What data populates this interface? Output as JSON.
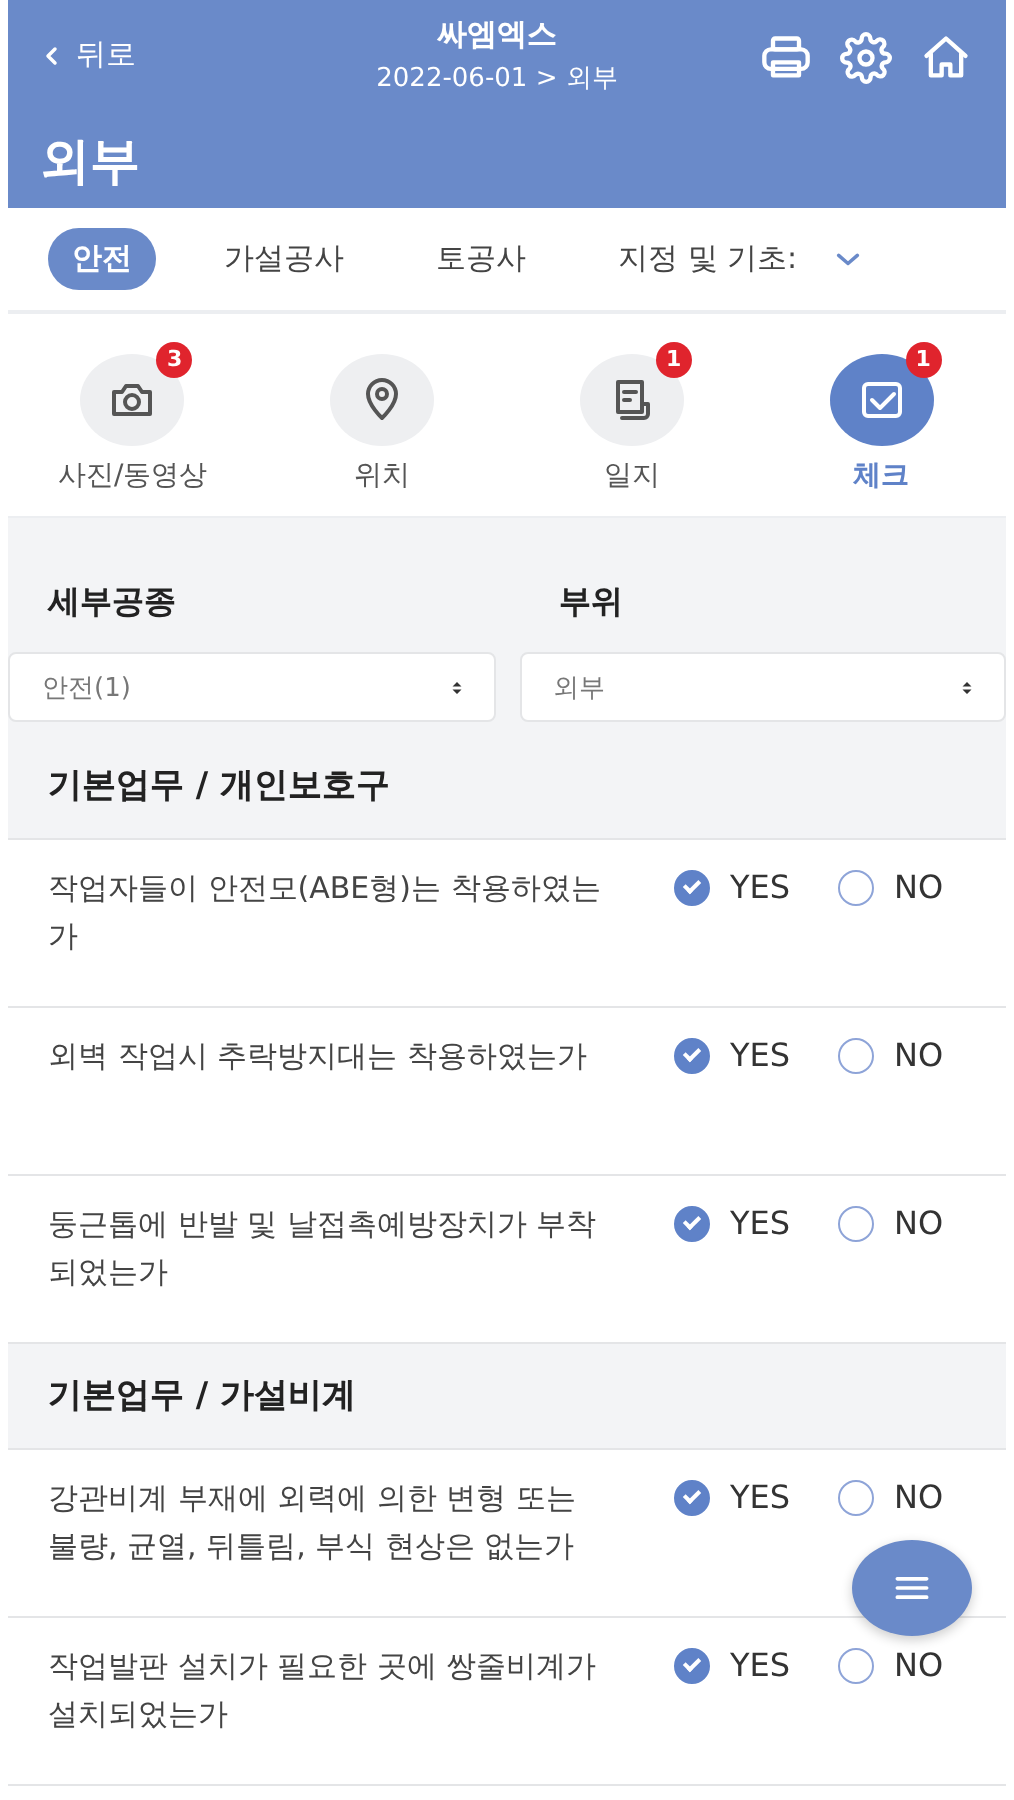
{
  "header": {
    "back": "뒤로",
    "app_title": "싸엠엑스",
    "breadcrumb": "2022-06-01 > 외부",
    "page_title": "외부"
  },
  "tabs": [
    {
      "label": "안전",
      "selected": true
    },
    {
      "label": "가설공사",
      "selected": false
    },
    {
      "label": "토공사",
      "selected": false
    },
    {
      "label": "지정 및 기초:",
      "selected": false
    }
  ],
  "actions": [
    {
      "label": "사진/동영상",
      "badge": "3",
      "selected": false
    },
    {
      "label": "위치",
      "selected": false
    },
    {
      "label": "일지",
      "badge": "1",
      "selected": false
    },
    {
      "label": "체크",
      "badge": "1",
      "selected": true
    }
  ],
  "filters": [
    {
      "label": "세부공종",
      "value": "안전(1)"
    },
    {
      "label": "부위",
      "value": "외부"
    }
  ],
  "sections": [
    {
      "title": "기본업무 / 개인보호구",
      "questions": [
        {
          "text": "작업자들이 안전모(ABE형)는 착용하였는가",
          "options": [
            {
              "label": "YES",
              "selected": true
            },
            {
              "label": "NO",
              "selected": false
            }
          ]
        },
        {
          "text": "외벽 작업시 추락방지대는 착용하였는가",
          "options": [
            {
              "label": "YES",
              "selected": true
            },
            {
              "label": "NO",
              "selected": false
            }
          ]
        },
        {
          "text": "둥근톱에 반발 및 날접촉예방장치가 부착되었는가",
          "options": [
            {
              "label": "YES",
              "selected": true
            },
            {
              "label": "NO",
              "selected": false
            }
          ]
        }
      ]
    },
    {
      "title": "기본업무 / 가설비계",
      "questions": [
        {
          "text": "강관비계 부재에 외력에 의한 변형 또는 불량, 균열, 뒤틀림, 부식 현상은 없는가",
          "options": [
            {
              "label": "YES",
              "selected": true
            },
            {
              "label": "NO",
              "selected": false
            }
          ]
        },
        {
          "text": "작업발판 설치가 필요한 곳에 쌍줄비계가 설치되었는가",
          "options": [
            {
              "label": "YES",
              "selected": true
            },
            {
              "label": "NO",
              "selected": false
            }
          ]
        }
      ]
    }
  ]
}
